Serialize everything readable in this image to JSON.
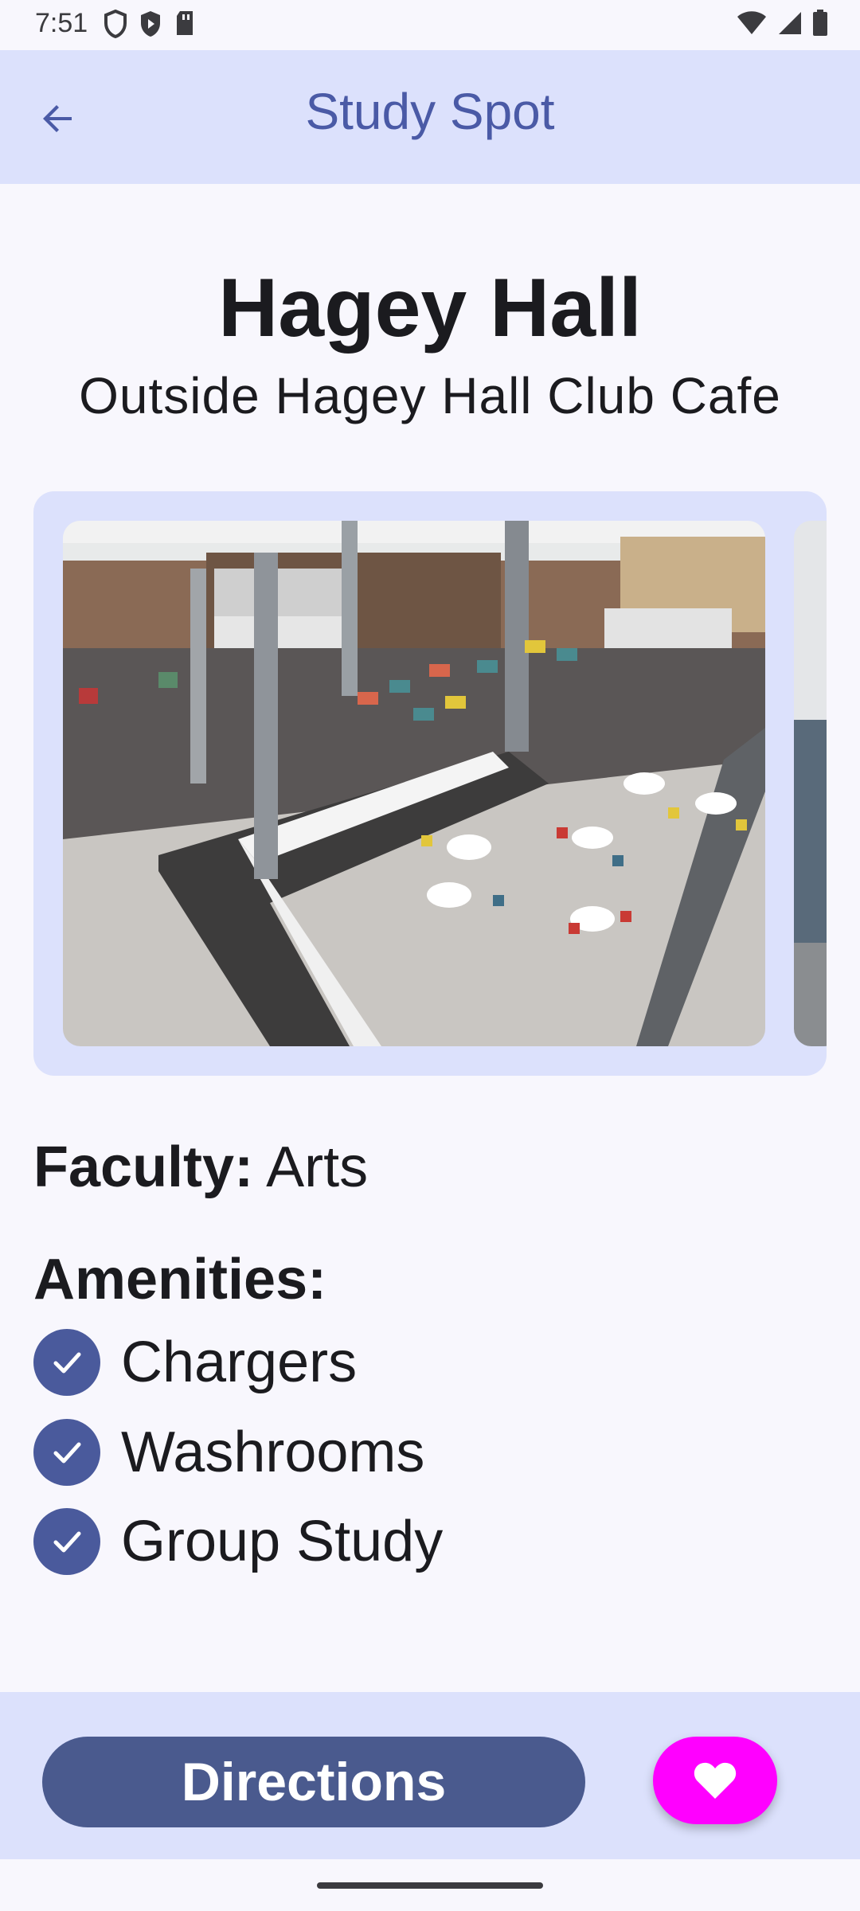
{
  "status_bar": {
    "time": "7:51"
  },
  "app_bar": {
    "title": "Study Spot"
  },
  "spot": {
    "name": "Hagey Hall",
    "location": "Outside Hagey Hall Club Cafe"
  },
  "details": {
    "faculty_label": "Faculty:",
    "faculty_value": "Arts",
    "amenities_label": "Amenities:",
    "amenities": [
      {
        "label": "Chargers"
      },
      {
        "label": "Washrooms"
      },
      {
        "label": "Group Study"
      }
    ]
  },
  "actions": {
    "directions_label": "Directions",
    "favorite_icon": "heart-icon"
  },
  "colors": {
    "app_bar": "#dce1fc",
    "title": "#4a5aa6",
    "check": "#4a5a9c",
    "directions": "#4a5a8e",
    "favorite": "#ff00ff"
  }
}
